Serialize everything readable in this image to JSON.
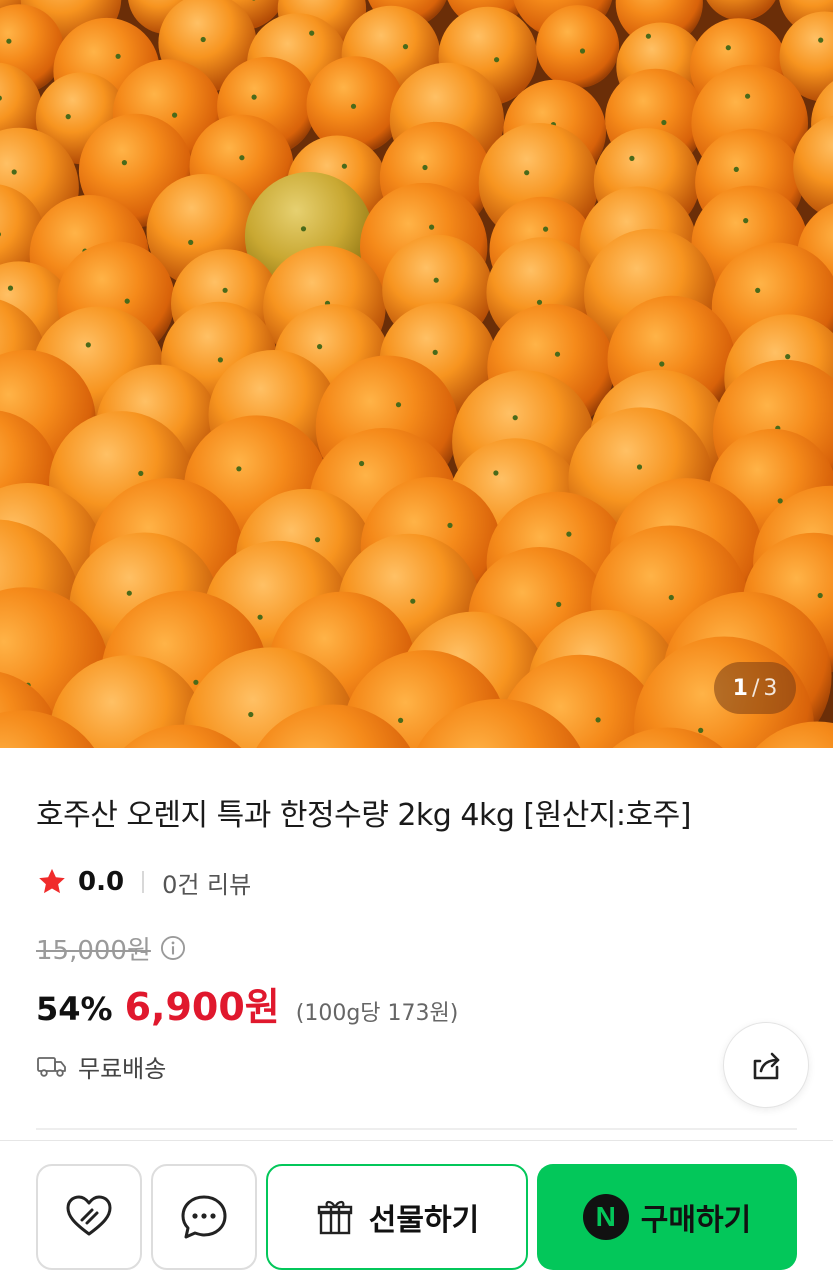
{
  "gallery": {
    "current": "1",
    "separator": "/",
    "total": "3",
    "image_subject": "oranges"
  },
  "product": {
    "title": "호주산 오렌지 특과 한정수량 2kg 4kg [원산지:호주]",
    "rating": "0.0",
    "review_count": "0건 리뷰",
    "original_price": "15,000원",
    "discount": "54%",
    "price": "6,900원",
    "unit_price": "(100g당 173원)",
    "shipping": "무료배송"
  },
  "actions": {
    "gift_label": "선물하기",
    "buy_label": "구매하기",
    "buy_logo": "N"
  },
  "icons": {
    "wish": "heart-icon",
    "chat": "chat-bubble-icon",
    "gift": "gift-box-icon",
    "share": "share-icon",
    "shipping": "truck-icon",
    "info": "info-icon",
    "star": "star-icon"
  },
  "colors": {
    "accent_green": "#03c75a",
    "price_red": "#e0182d",
    "star_red": "#f02b2b",
    "orange": "#f07a10"
  }
}
